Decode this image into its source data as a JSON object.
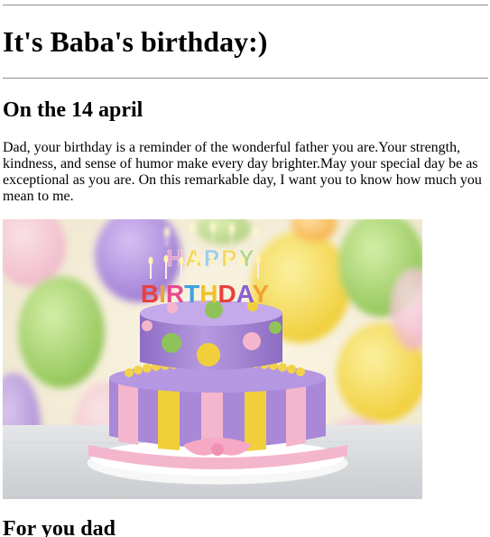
{
  "page": {
    "title": "It's Baba's birthday:)",
    "date_heading": "On the 14 april",
    "message": "Dad, your birthday is a reminder of the wonderful father you are.Your strength, kindness, and sense of humor make every day brighter.May your special day be as exceptional as you are. On this remarkable day, I want you to know how much you mean to me.",
    "footer_heading": "For you dad"
  },
  "image": {
    "subject": "birthday-cake-photo",
    "topper_line1": "HAPPY",
    "topper_line2": "BIRTHDAY"
  },
  "colors": {
    "rule": "#9a9a9a",
    "cake_purple": "#9d7fd0",
    "cake_yellow": "#f1cf3a",
    "cake_pink": "#f4b6cc",
    "cake_green": "#8bbf5a"
  }
}
